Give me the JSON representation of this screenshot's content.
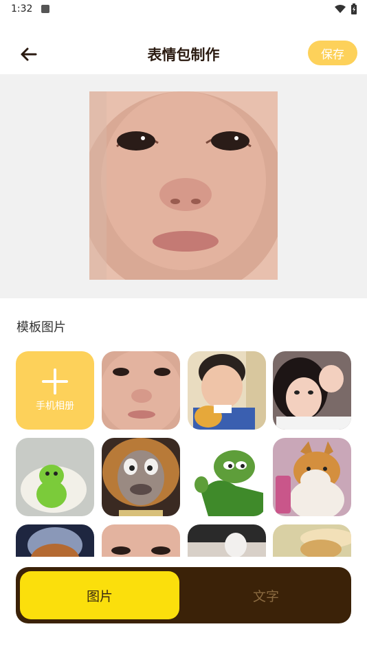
{
  "status_bar": {
    "time": "1:32",
    "icons": [
      "notification-icon",
      "wifi-icon",
      "battery-icon"
    ]
  },
  "app_bar": {
    "back_icon": "arrow-left-icon",
    "title": "表情包制作",
    "save_label": "保存"
  },
  "colors": {
    "accent": "#fdd15a",
    "bottom_bar": "#3b2208",
    "active_tab": "#fbdf0c",
    "preview_bg": "#f1f1f1"
  },
  "templates": {
    "section_title": "模板图片",
    "album_label": "手机相册",
    "album_icon": "plus-icon",
    "items": [
      "crying-baby",
      "baby-eating",
      "girl-pose",
      "green-figure",
      "talking-dog",
      "pepe-frog",
      "shiba-phone",
      "shiba-hat",
      "baby-eyes",
      "hands-cup",
      "food-bowl"
    ]
  },
  "bottom_tabs": {
    "image_tab": "图片",
    "text_tab": "文字",
    "active": "image"
  }
}
